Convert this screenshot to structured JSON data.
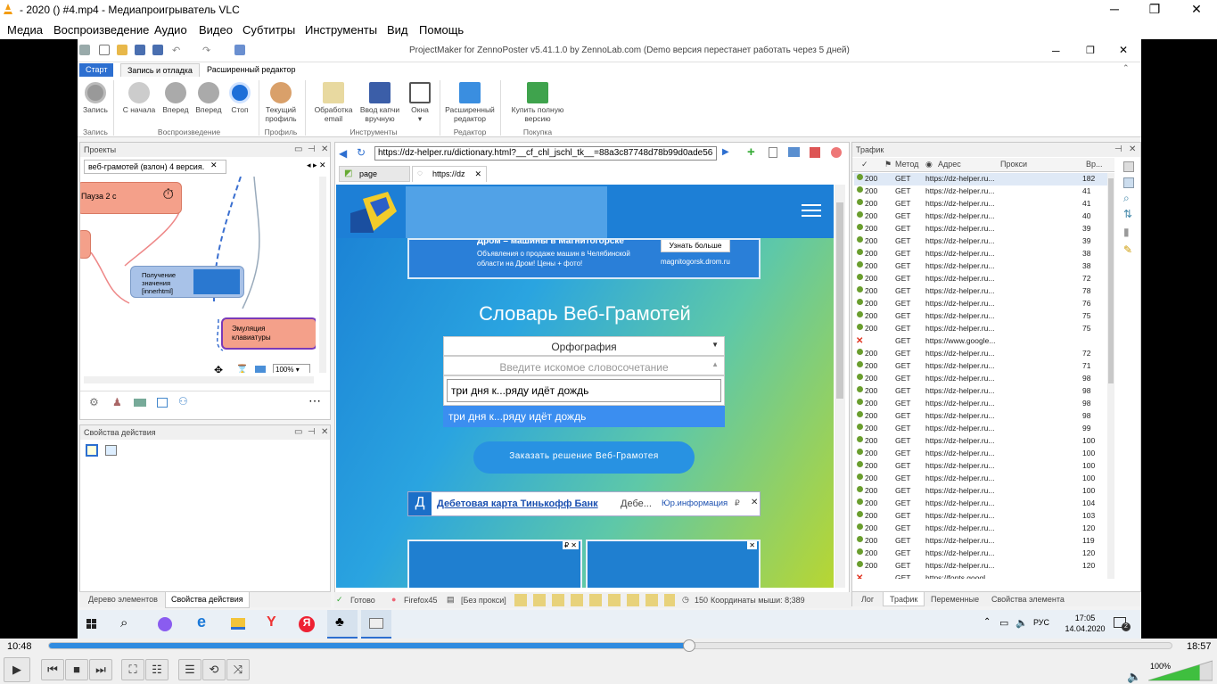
{
  "vlc": {
    "title": "- 2020 () #4.mp4 - Медиапроигрыватель VLC",
    "menu": [
      "Медиа",
      "Воспроизведение",
      "Аудио",
      "Видео",
      "Субтитры",
      "Инструменты",
      "Вид",
      "Помощь"
    ],
    "time_current": "10:48",
    "time_total": "18:57",
    "progress": 0.57,
    "volume": "100%"
  },
  "pm": {
    "title": "ProjectMaker for ZennoPoster v5.41.1.0 by ZennoLab.com (Demo версия перестанет работать через 5 дней)",
    "tabs": [
      "Старт",
      "Запись и отладка",
      "Расширенный редактор"
    ],
    "ribbon": {
      "record": "Запись",
      "from_start": "С начала",
      "forward1": "Вперед",
      "forward2": "Вперед",
      "stop": "Стоп",
      "current_profile": "Текущий профиль",
      "email": "Обработка email",
      "captcha": "Ввод капчи вручную",
      "windows": "Окна",
      "ext_editor": "Расширенный редактор",
      "buy": "Купить полную версию",
      "groups": [
        "Запись",
        "Воспроизведение",
        "Профиль",
        "Инструменты",
        "Редактор",
        "Покупка"
      ]
    },
    "projects": {
      "title": "Проекты",
      "tab": "веб-грамотей (взлон) 4 версия.",
      "node1": "Пауза 2 с",
      "node2": "Получение значения [innerhtml]",
      "node3": "Эмуляция клавиатуры",
      "zoom": "100%"
    },
    "props": {
      "title": "Свойства действия",
      "tabs": [
        "Дерево элементов",
        "Свойства действия"
      ]
    },
    "browser": {
      "address": "https://dz-helper.ru/dictionary.html?__cf_chl_jschl_tk__=88a3c87748d78b99d0ade56",
      "tabs": [
        "page",
        "https://dz"
      ]
    },
    "web": {
      "ad_top_title": "Дром – машины в Магнитогорске",
      "ad_top_text": "Объявления о продаже машин в Челябинской области на Дром! Цены + фото!",
      "ad_top_button": "Узнать больше",
      "ad_top_domain": "magnitogorsk.drom.ru",
      "heading": "Словарь Веб-Грамотей",
      "select_value": "Орфография",
      "select_placeholder": "Введите искомое словосочетание",
      "input_value": "три дня к...ряду идёт дождь",
      "suggestion": "три дня к...ряду идёт дождь",
      "order_button": "Заказать решение Веб-Грамотея",
      "ad_bottom_letter": "Д",
      "ad_bottom_link": "Дебетовая карта Тинькофф Банк",
      "ad_bottom_text": "Дебе...",
      "ad_bottom_info": "Юр.информация"
    },
    "traffic": {
      "title": "Трафик",
      "headers": [
        "Метод",
        "Адрес",
        "Прокси",
        "Вр..."
      ],
      "rows": [
        {
          "status": "200",
          "method": "GET",
          "url": "https://dz-helper.ru...",
          "time": "182"
        },
        {
          "status": "200",
          "method": "GET",
          "url": "https://dz-helper.ru...",
          "time": "41"
        },
        {
          "status": "200",
          "method": "GET",
          "url": "https://dz-helper.ru...",
          "time": "41"
        },
        {
          "status": "200",
          "method": "GET",
          "url": "https://dz-helper.ru...",
          "time": "40"
        },
        {
          "status": "200",
          "method": "GET",
          "url": "https://dz-helper.ru...",
          "time": "39"
        },
        {
          "status": "200",
          "method": "GET",
          "url": "https://dz-helper.ru...",
          "time": "39"
        },
        {
          "status": "200",
          "method": "GET",
          "url": "https://dz-helper.ru...",
          "time": "38"
        },
        {
          "status": "200",
          "method": "GET",
          "url": "https://dz-helper.ru...",
          "time": "38"
        },
        {
          "status": "200",
          "method": "GET",
          "url": "https://dz-helper.ru...",
          "time": "72"
        },
        {
          "status": "200",
          "method": "GET",
          "url": "https://dz-helper.ru...",
          "time": "78"
        },
        {
          "status": "200",
          "method": "GET",
          "url": "https://dz-helper.ru...",
          "time": "76"
        },
        {
          "status": "200",
          "method": "GET",
          "url": "https://dz-helper.ru...",
          "time": "75"
        },
        {
          "status": "200",
          "method": "GET",
          "url": "https://dz-helper.ru...",
          "time": "75"
        },
        {
          "status": "",
          "method": "GET",
          "url": "https://www.google...",
          "time": ""
        },
        {
          "status": "200",
          "method": "GET",
          "url": "https://dz-helper.ru...",
          "time": "72"
        },
        {
          "status": "200",
          "method": "GET",
          "url": "https://dz-helper.ru...",
          "time": "71"
        },
        {
          "status": "200",
          "method": "GET",
          "url": "https://dz-helper.ru...",
          "time": "98"
        },
        {
          "status": "200",
          "method": "GET",
          "url": "https://dz-helper.ru...",
          "time": "98"
        },
        {
          "status": "200",
          "method": "GET",
          "url": "https://dz-helper.ru...",
          "time": "98"
        },
        {
          "status": "200",
          "method": "GET",
          "url": "https://dz-helper.ru...",
          "time": "98"
        },
        {
          "status": "200",
          "method": "GET",
          "url": "https://dz-helper.ru...",
          "time": "99"
        },
        {
          "status": "200",
          "method": "GET",
          "url": "https://dz-helper.ru...",
          "time": "100"
        },
        {
          "status": "200",
          "method": "GET",
          "url": "https://dz-helper.ru...",
          "time": "100"
        },
        {
          "status": "200",
          "method": "GET",
          "url": "https://dz-helper.ru...",
          "time": "100"
        },
        {
          "status": "200",
          "method": "GET",
          "url": "https://dz-helper.ru...",
          "time": "100"
        },
        {
          "status": "200",
          "method": "GET",
          "url": "https://dz-helper.ru...",
          "time": "100"
        },
        {
          "status": "200",
          "method": "GET",
          "url": "https://dz-helper.ru...",
          "time": "104"
        },
        {
          "status": "200",
          "method": "GET",
          "url": "https://dz-helper.ru...",
          "time": "103"
        },
        {
          "status": "200",
          "method": "GET",
          "url": "https://dz-helper.ru...",
          "time": "120"
        },
        {
          "status": "200",
          "method": "GET",
          "url": "https://dz-helper.ru...",
          "time": "119"
        },
        {
          "status": "200",
          "method": "GET",
          "url": "https://dz-helper.ru...",
          "time": "120"
        },
        {
          "status": "200",
          "method": "GET",
          "url": "https://dz-helper.ru...",
          "time": "120"
        },
        {
          "status": "",
          "method": "GET",
          "url": "https://fonts.googl...",
          "time": ""
        }
      ],
      "bottom_tabs": [
        "Лог",
        "Трафик",
        "Переменные",
        "Свойства элемента"
      ]
    },
    "status": {
      "ready": "Готово",
      "browser": "Firefox45",
      "proxy": "[Без прокси]",
      "delay": "150",
      "coords": "Координаты мыши: 8;389"
    },
    "taskbar": {
      "lang": "РУС",
      "time": "17:05",
      "date": "14.04.2020",
      "notif": "2"
    }
  }
}
